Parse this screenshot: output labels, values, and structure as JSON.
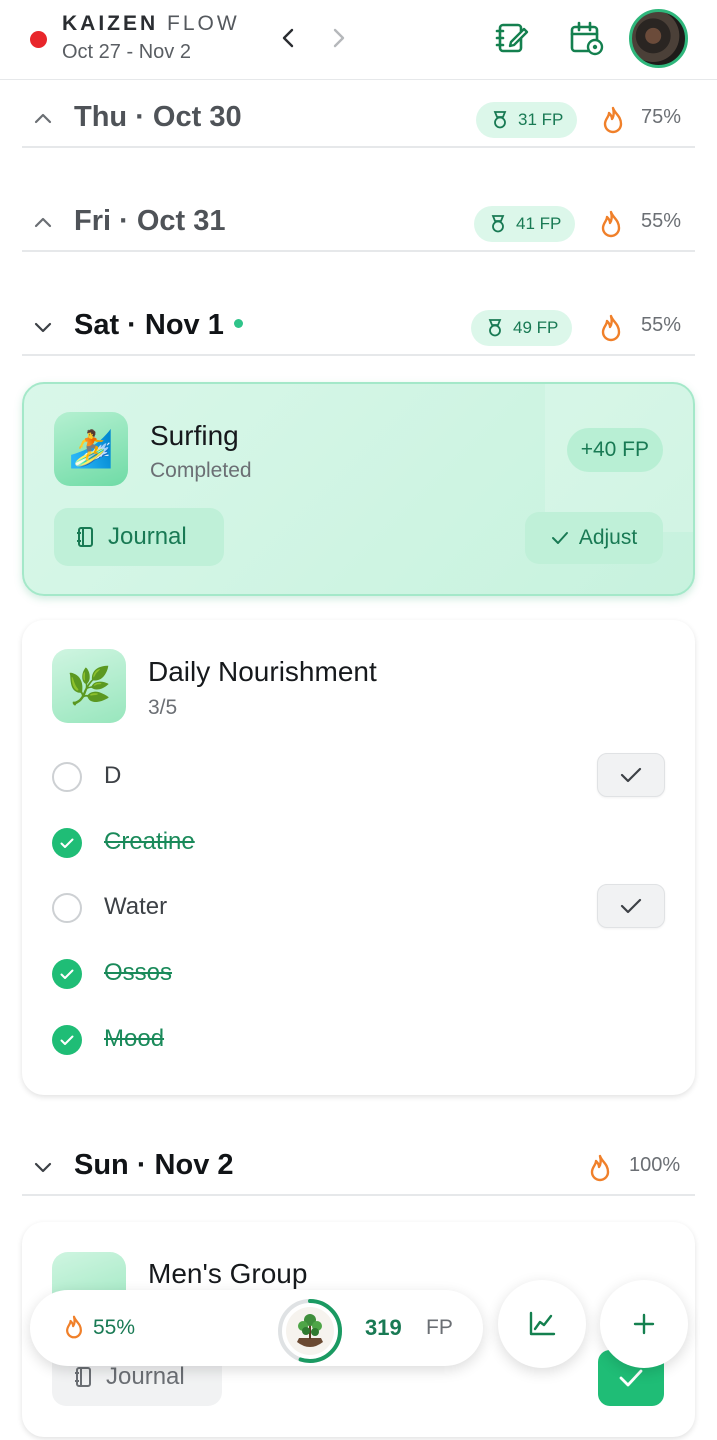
{
  "header": {
    "brand_bold": "KAIZEN",
    "brand_light": "FLOW",
    "date_range": "Oct 27 - Nov 2"
  },
  "days": [
    {
      "label": "Thu · Oct 30",
      "fp": "31 FP",
      "pct": "75%",
      "expanded": false
    },
    {
      "label": "Fri · Oct 31",
      "fp": "41 FP",
      "pct": "55%",
      "expanded": false
    },
    {
      "label": "Sat · Nov 1",
      "fp": "49 FP",
      "pct": "55%",
      "expanded": true,
      "today": true
    },
    {
      "label": "Sun · Nov 2",
      "pct": "100%",
      "expanded": true
    }
  ],
  "surfing": {
    "title": "Surfing",
    "status": "Completed",
    "fp": "+40 FP",
    "journal": "Journal",
    "adjust": "Adjust"
  },
  "nourishment": {
    "title": "Daily Nourishment",
    "progress": "3/5",
    "items": [
      {
        "label": "D",
        "done": false
      },
      {
        "label": "Creatine",
        "done": true
      },
      {
        "label": "Water",
        "done": false
      },
      {
        "label": "Ossos",
        "done": true
      },
      {
        "label": "Mood",
        "done": true
      }
    ]
  },
  "mens_group": {
    "title": "Men's Group",
    "journal": "Journal"
  },
  "bottom_bar": {
    "streak_pct": "55%",
    "fp_total": "319",
    "fp_unit": "FP",
    "ring_progress": 0.55
  },
  "colors": {
    "accent": "#1fbd76",
    "accent_dark": "#197a54",
    "flame": "#f0802a",
    "record": "#e8262b"
  }
}
